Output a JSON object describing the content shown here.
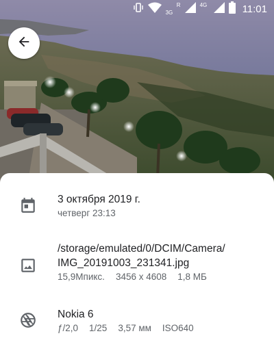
{
  "status_bar": {
    "time": "11:01",
    "network_3g": "3G",
    "network_r": "R",
    "network_4g": "4G",
    "icons": [
      "vibrate-icon",
      "wifi-icon",
      "signal-icon",
      "signal-icon",
      "battery-icon"
    ]
  },
  "toolbar": {
    "back_icon": "arrow-back-icon"
  },
  "details": {
    "date": {
      "icon": "calendar-icon",
      "primary": "3 октября 2019 г.",
      "secondary": "четверг 23:13"
    },
    "file": {
      "icon": "image-icon",
      "path_line1": "/storage/emulated/0/DCIM/Camera/",
      "path_line2": "IMG_20191003_231341.jpg",
      "megapixels": "15,9Мпикс.",
      "resolution": "3456 x 4608",
      "size": "1,8 МБ"
    },
    "camera": {
      "icon": "aperture-icon",
      "model": "Nokia 6",
      "aperture": "ƒ/2,0",
      "exposure": "1/25",
      "focal_length": "3,57 мм",
      "iso": "ISO640"
    }
  }
}
